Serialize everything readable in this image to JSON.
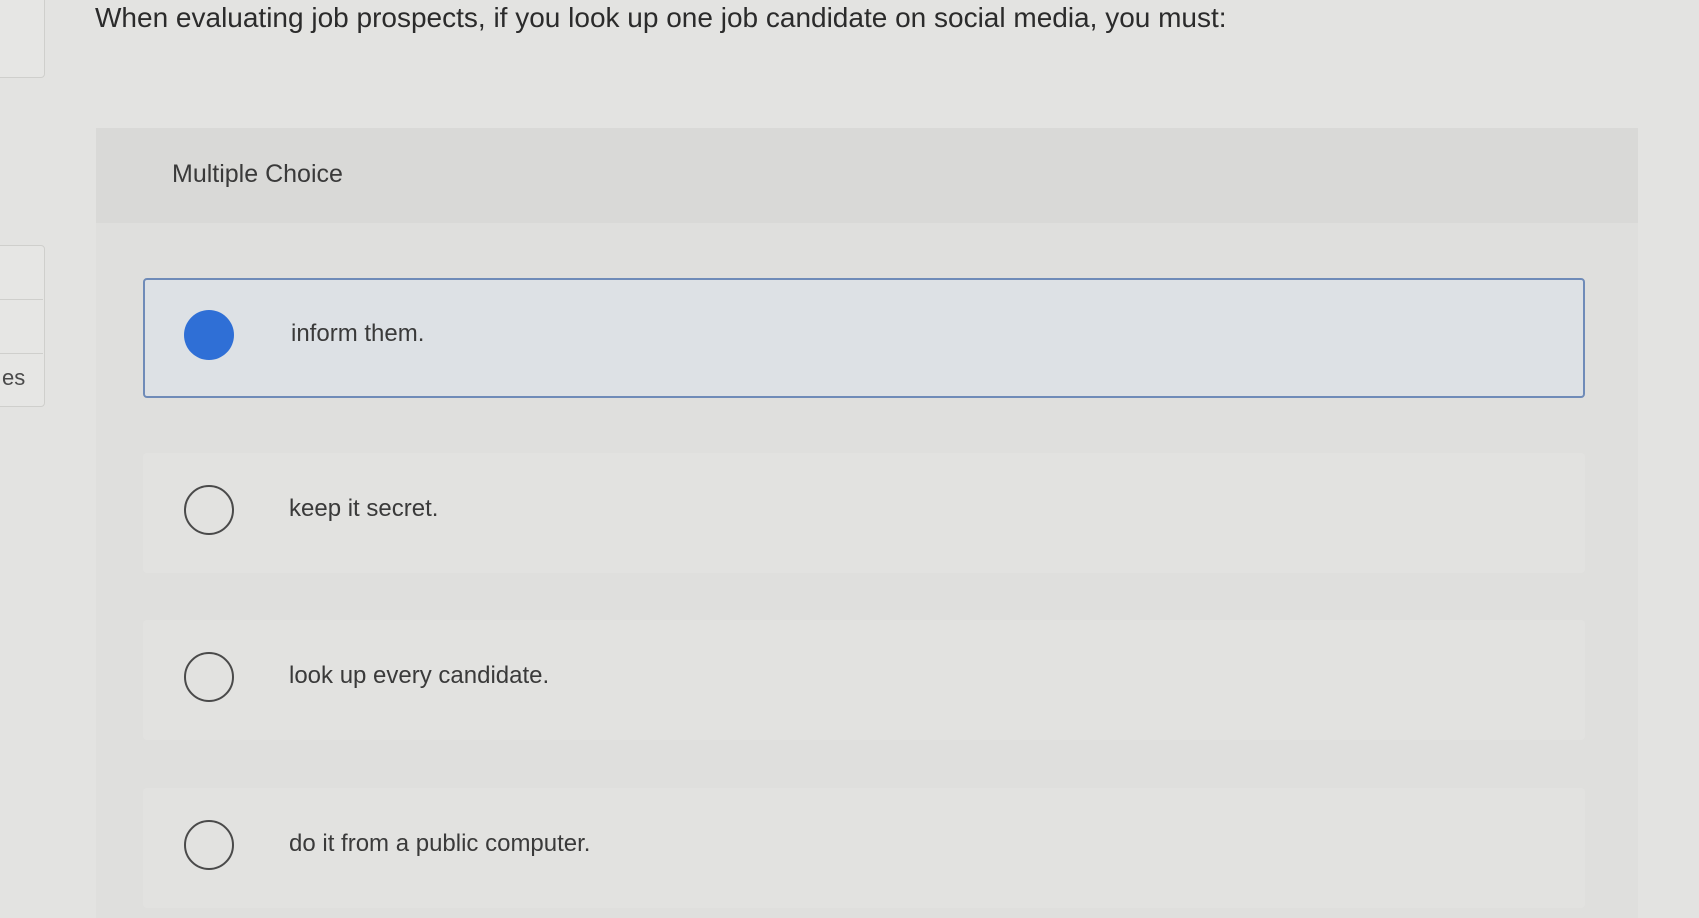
{
  "sidebar": {
    "partial_label": "es"
  },
  "question": {
    "text": "When evaluating job prospects, if you look up one job candidate on social media, you must:"
  },
  "multiple_choice": {
    "title": "Multiple Choice",
    "selected_index": 0,
    "options": [
      {
        "label": "inform them.",
        "selected": true
      },
      {
        "label": "keep it secret.",
        "selected": false
      },
      {
        "label": "look up every candidate.",
        "selected": false
      },
      {
        "label": "do it from a public computer.",
        "selected": false
      }
    ]
  },
  "colors": {
    "selected_radio": "#2f6fd6",
    "selected_border": "#6f8bb8"
  }
}
